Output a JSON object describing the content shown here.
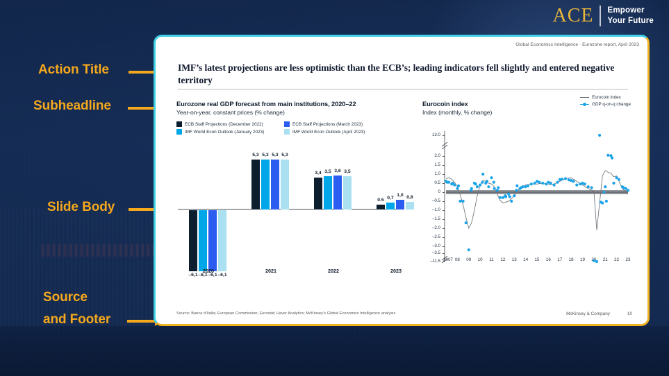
{
  "brand": {
    "name": "ACE",
    "tagline_line1": "Empower",
    "tagline_line2": "Your Future",
    "gold": "#e8b53a"
  },
  "annotations": [
    {
      "label": "Action Title"
    },
    {
      "label": "Subheadline"
    },
    {
      "label": "Slide Body"
    },
    {
      "label": "Source"
    },
    {
      "label": "and Footer"
    }
  ],
  "slide": {
    "kicker": "Global Economics Intelligence · Eurozone report, April 2023",
    "title": "IMF’s latest projections are less optimistic than the ECB’s; leading indicators fell slightly and entered negative territory",
    "source": "Source: Banca d’Italia; European Commission; Eurostat; Haver Analytics; McKinsey’s Global Economics Intelligence analysis",
    "firm": "McKinsey & Company",
    "page": "10"
  },
  "chart_data": [
    {
      "type": "bar",
      "title": "Eurozone real GDP forecast from main institutions, 2020–22",
      "subtitle": "Year-on-year, constant prices (% change)",
      "xlabel": "",
      "ylabel": "",
      "categories": [
        "2020",
        "2021",
        "2022",
        "2023"
      ],
      "series": [
        {
          "name": "ECB Staff Projections (December 2022)",
          "color": "#0d1f2e",
          "values": [
            -6.1,
            5.3,
            3.4,
            0.5
          ],
          "labels": [
            "–6,1",
            "5,3",
            "3,4",
            "0.5"
          ]
        },
        {
          "name": "IMF World Econ Outlook (January 2023)",
          "color": "#00a7e8",
          "values": [
            -6.1,
            5.3,
            3.5,
            0.7
          ],
          "labels": [
            "–6,1",
            "5,3",
            "3,5",
            "0,7"
          ]
        },
        {
          "name": "ECB Staff Projections (March 2023)",
          "color": "#2b5df0",
          "values": [
            -6.1,
            5.3,
            3.6,
            1.0
          ],
          "labels": [
            "–6,1",
            "5,3",
            "3,6",
            "1,0"
          ]
        },
        {
          "name": "IMF World Econ Outlook (April 2023)",
          "color": "#aae1f0",
          "values": [
            -6.1,
            5.3,
            3.5,
            0.8
          ],
          "labels": [
            "–6,1",
            "5,3",
            "3,5",
            "0,8"
          ]
        }
      ],
      "legend_position": "top",
      "grid": false
    },
    {
      "type": "line",
      "title": "Eurocoin index",
      "subtitle": "Index (monthly, % change)",
      "xlabel": "",
      "ylabel": "",
      "legend": [
        {
          "name": "Eurocoin index",
          "color": "#6d7278",
          "style": "line"
        },
        {
          "name": "GDP q-on-q change",
          "color": "#1ba3e8",
          "style": "line-markers"
        }
      ],
      "yticks": [
        "13.0",
        "2.0",
        "1.5",
        "1.0",
        "0.5",
        "0",
        "–0.5",
        "–1.0",
        "–1.5",
        "–2.0",
        "–2.5",
        "–3.0",
        "–3.5",
        "–11.5"
      ],
      "xticks": [
        "2007",
        "08",
        "09",
        "10",
        "11",
        "12",
        "13",
        "14",
        "15",
        "16",
        "17",
        "18",
        "19",
        "20",
        "21",
        "22",
        "23"
      ],
      "axis_break": true,
      "ylim": [
        -11.5,
        13.0
      ],
      "grid": false,
      "series": [
        {
          "name": "Eurocoin index",
          "color": "#6d7278",
          "x": [
            2007.0,
            2007.25,
            2007.5,
            2007.75,
            2008.0,
            2008.25,
            2008.5,
            2008.75,
            2009.0,
            2009.25,
            2009.5,
            2009.75,
            2010.0,
            2010.25,
            2010.5,
            2010.75,
            2011.0,
            2011.25,
            2011.5,
            2011.75,
            2012.0,
            2012.25,
            2012.5,
            2012.75,
            2013.0,
            2013.25,
            2013.5,
            2013.75,
            2014.0,
            2014.5,
            2015.0,
            2015.5,
            2016.0,
            2016.5,
            2017.0,
            2017.5,
            2018.0,
            2018.5,
            2019.0,
            2019.5,
            2020.0,
            2020.25,
            2020.5,
            2020.75,
            2021.0,
            2021.25,
            2021.5,
            2021.75,
            2022.0,
            2022.5,
            2023.0
          ],
          "y": [
            0.75,
            0.8,
            0.72,
            0.55,
            0.3,
            -0.15,
            -0.7,
            -1.4,
            -2.0,
            -1.7,
            -1.0,
            -0.2,
            0.4,
            0.65,
            0.6,
            0.5,
            0.45,
            0.3,
            -0.1,
            -0.45,
            -0.6,
            -0.55,
            -0.5,
            -0.35,
            -0.2,
            0.05,
            0.2,
            0.3,
            0.4,
            0.45,
            0.45,
            0.5,
            0.4,
            0.45,
            0.6,
            0.75,
            0.8,
            0.6,
            0.4,
            0.2,
            0.05,
            -2.1,
            -0.6,
            0.9,
            1.2,
            1.1,
            1.05,
            0.85,
            0.9,
            0.2,
            -0.1
          ]
        },
        {
          "name": "GDP q-on-q change",
          "color": "#1ba3e8",
          "x": [
            2007.0,
            2007.25,
            2007.5,
            2007.75,
            2008.0,
            2008.25,
            2008.5,
            2008.75,
            2009.0,
            2009.25,
            2009.5,
            2009.75,
            2010.0,
            2010.25,
            2010.5,
            2010.75,
            2011.0,
            2011.25,
            2011.5,
            2011.75,
            2012.0,
            2012.25,
            2012.5,
            2012.75,
            2013.0,
            2013.25,
            2013.5,
            2013.75,
            2014.0,
            2014.5,
            2015.0,
            2015.5,
            2016.0,
            2016.5,
            2017.0,
            2017.5,
            2018.0,
            2018.5,
            2019.0,
            2019.5,
            2020.0,
            2020.25,
            2020.5,
            2020.75,
            2021.0,
            2021.25,
            2021.5,
            2021.75,
            2022.0,
            2022.5,
            2023.0
          ],
          "y": [
            0.6,
            0.55,
            0.45,
            0.4,
            0.2,
            -0.5,
            -0.5,
            -1.7,
            -3.2,
            0.2,
            0.5,
            0.3,
            0.4,
            1.0,
            0.5,
            0.3,
            0.8,
            0.2,
            0.1,
            -0.3,
            -0.3,
            -0.25,
            -0.1,
            -0.5,
            -0.2,
            0.35,
            0.2,
            0.3,
            0.3,
            0.45,
            0.6,
            0.5,
            0.55,
            0.4,
            0.7,
            0.75,
            0.65,
            0.4,
            0.5,
            0.3,
            -3.8,
            -11.5,
            13.0,
            -0.6,
            0.3,
            2.2,
            2.1,
            0.5,
            0.8,
            0.3,
            0.1
          ]
        }
      ]
    }
  ]
}
